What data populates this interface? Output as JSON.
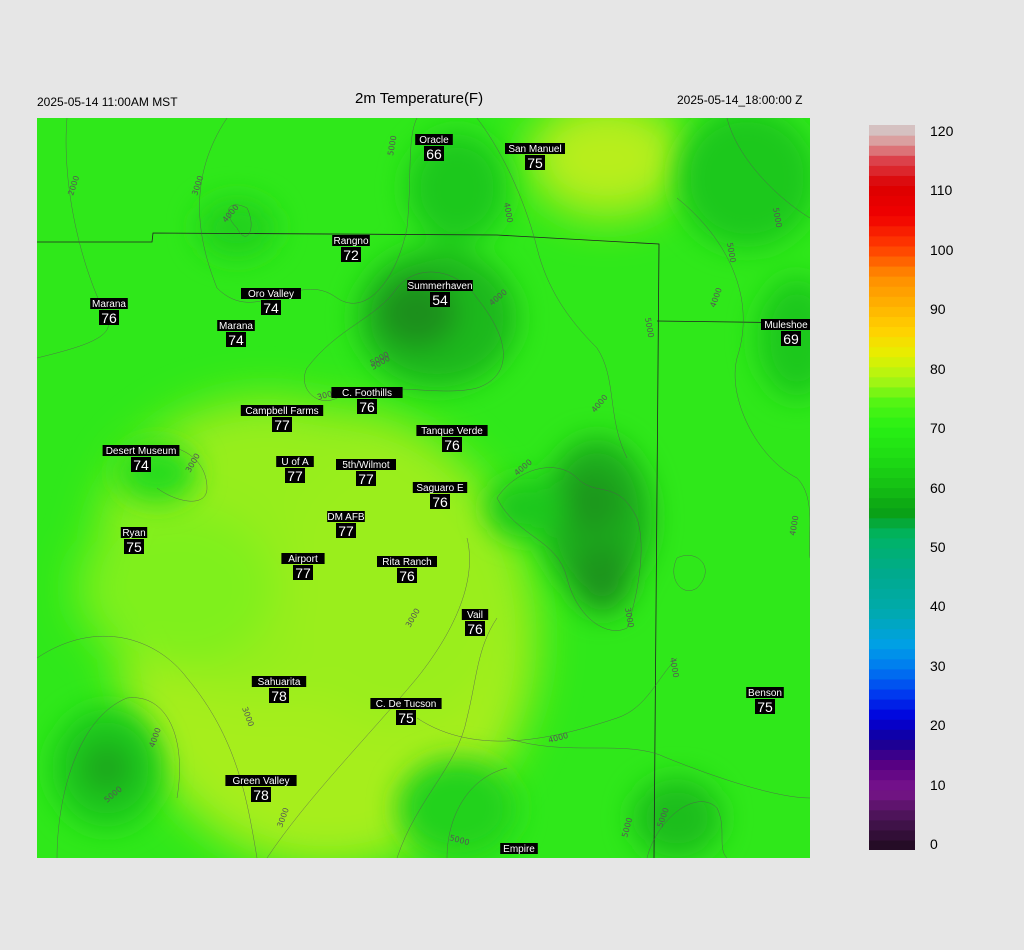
{
  "header": {
    "local_time": "2025-05-14 11:00AM MST",
    "title": "2m Temperature(F)",
    "utc_time": "2025-05-14_18:00:00 Z"
  },
  "stations": [
    {
      "name": "Oracle",
      "temp": "66"
    },
    {
      "name": "San Manuel",
      "temp": "75"
    },
    {
      "name": "Rangno",
      "temp": "72"
    },
    {
      "name": "Summerhaven",
      "temp": "54"
    },
    {
      "name": "Marana",
      "temp": "76"
    },
    {
      "name": "Oro Valley",
      "temp": "74"
    },
    {
      "name": "Marana",
      "temp": "74"
    },
    {
      "name": "Muleshoe R",
      "temp": "69"
    },
    {
      "name": "C. Foothills",
      "temp": "76"
    },
    {
      "name": "Campbell Farms",
      "temp": "77"
    },
    {
      "name": "Tanque Verde",
      "temp": "76"
    },
    {
      "name": "Desert Museum",
      "temp": "74"
    },
    {
      "name": "U of A",
      "temp": "77"
    },
    {
      "name": "5th/Wilmot",
      "temp": "77"
    },
    {
      "name": "Saguaro E",
      "temp": "76"
    },
    {
      "name": "DM AFB",
      "temp": "77"
    },
    {
      "name": "Ryan",
      "temp": "75"
    },
    {
      "name": "Airport",
      "temp": "77"
    },
    {
      "name": "Rita Ranch",
      "temp": "76"
    },
    {
      "name": "Vail",
      "temp": "76"
    },
    {
      "name": "Sahuarita",
      "temp": "78"
    },
    {
      "name": "C. De Tucson",
      "temp": "75"
    },
    {
      "name": "Benson",
      "temp": "75"
    },
    {
      "name": "Green Valley",
      "temp": "78"
    },
    {
      "name": "Empire",
      "temp": ""
    }
  ],
  "contours": [
    {
      "label": "2000"
    },
    {
      "label": "3000"
    },
    {
      "label": "4000"
    },
    {
      "label": "5000"
    },
    {
      "label": "4000"
    },
    {
      "label": "4000"
    },
    {
      "label": "5000"
    },
    {
      "label": "5000"
    },
    {
      "label": "3000"
    },
    {
      "label": "3000"
    },
    {
      "label": "4000"
    },
    {
      "label": "4000"
    },
    {
      "label": "4000"
    },
    {
      "label": "5000"
    },
    {
      "label": "5000"
    },
    {
      "label": "4000"
    },
    {
      "label": "3000"
    },
    {
      "label": "3000"
    },
    {
      "label": "3000"
    },
    {
      "label": "4000"
    },
    {
      "label": "5000"
    },
    {
      "label": "3000"
    },
    {
      "label": "4000"
    },
    {
      "label": "5000"
    },
    {
      "label": "5000"
    },
    {
      "label": "5000"
    },
    {
      "label": "5000"
    },
    {
      "label": "4000"
    }
  ],
  "colorbar": {
    "ticks": [
      "0",
      "10",
      "20",
      "30",
      "40",
      "50",
      "60",
      "70",
      "80",
      "90",
      "100",
      "110",
      "120"
    ],
    "min": 0,
    "max": 120
  }
}
